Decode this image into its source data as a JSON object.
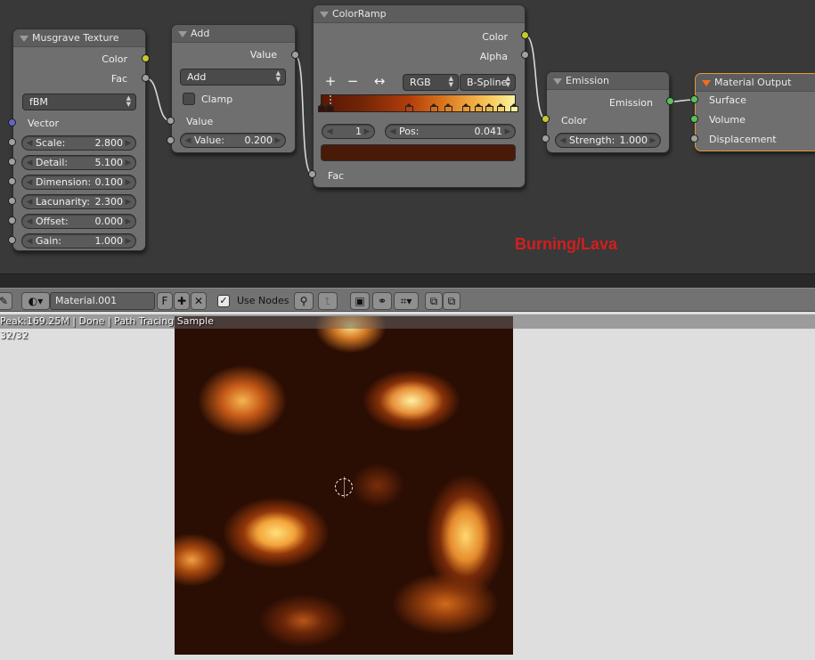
{
  "nodes": {
    "musgrave": {
      "title": "Musgrave Texture",
      "out_color": "Color",
      "out_fac": "Fac",
      "type_value": "fBM",
      "in_vector": "Vector",
      "fields": [
        {
          "label": "Scale:",
          "value": "2.800"
        },
        {
          "label": "Detail:",
          "value": "5.100"
        },
        {
          "label": "Dimension:",
          "value": "0.100"
        },
        {
          "label": "Lacunarity:",
          "value": "2.300"
        },
        {
          "label": "Offset:",
          "value": "0.000"
        },
        {
          "label": "Gain:",
          "value": "1.000"
        }
      ]
    },
    "add": {
      "title": "Add",
      "out_value": "Value",
      "operation": "Add",
      "clamp_label": "Clamp",
      "in_value": "Value",
      "field": {
        "label": "Value:",
        "value": "0.200"
      }
    },
    "colorramp": {
      "title": "ColorRamp",
      "out_color": "Color",
      "out_alpha": "Alpha",
      "plus": "+",
      "minus": "−",
      "flip": "↔",
      "color_mode": "RGB",
      "interpolation": "B-Spline",
      "stop_index": "1",
      "pos_label": "Pos:",
      "pos_value": "0.041",
      "in_fac": "Fac",
      "stop_colors": [
        "#3a1004",
        "#3a1004",
        "#b8420e",
        "#d46a18",
        "#e08422",
        "#e89a30",
        "#eda83a",
        "#f0b848",
        "#f5cc60",
        "#faf0a0"
      ],
      "swatch_color": "#4a1a08"
    },
    "emission": {
      "title": "Emission",
      "out_emission": "Emission",
      "in_color": "Color",
      "field": {
        "label": "Strength:",
        "value": "1.000"
      }
    },
    "output": {
      "title": "Material Output",
      "in_surface": "Surface",
      "in_volume": "Volume",
      "in_displacement": "Displacement"
    }
  },
  "watermark": "Burning/Lava",
  "toolbar": {
    "material_name": "Material.001",
    "fake_user": "F",
    "new_icon": "plus-icon",
    "unlink_icon": "x-icon",
    "use_nodes_label": "Use Nodes",
    "use_nodes_checked": "✓"
  },
  "render": {
    "status": "Peak:169.25M | Done | Path Tracing Sample 32/32"
  },
  "colors": {
    "socket_color": "#c8c82f",
    "socket_float": "#a0a0a0",
    "socket_vector": "#6363c7",
    "socket_shader": "#5cc05c",
    "watermark": "#d41e1e"
  }
}
